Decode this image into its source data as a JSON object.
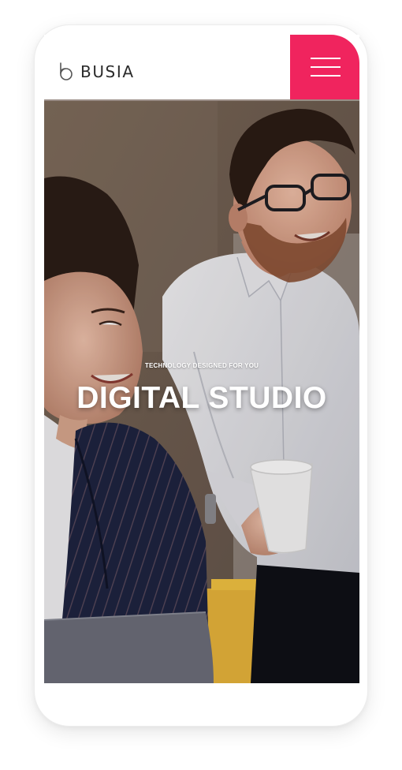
{
  "header": {
    "logo_text": "BUSIA",
    "menu_icon": "hamburger-menu-icon",
    "menu_color": "#f0245e"
  },
  "hero": {
    "tagline": "TECHNOLOGY DESIGNED FOR YOU",
    "title": "DIGITAL STUDIO"
  },
  "colors": {
    "accent": "#f0245e",
    "logo": "#2b2b2b",
    "hero_text": "#ffffff"
  }
}
